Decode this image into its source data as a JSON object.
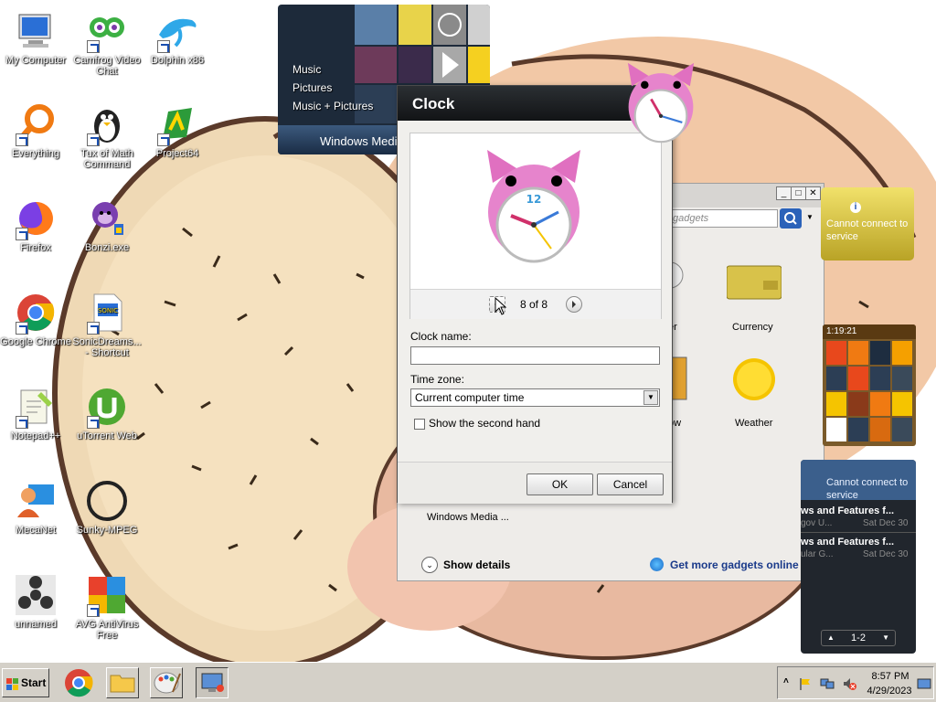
{
  "desktop": {
    "icons": [
      {
        "label": "My Computer",
        "shortcut": false
      },
      {
        "label": "Camfrog Video Chat",
        "shortcut": true
      },
      {
        "label": "Dolphin x86",
        "shortcut": true
      },
      {
        "label": "Everything",
        "shortcut": true
      },
      {
        "label": "Tux of Math Command",
        "shortcut": true
      },
      {
        "label": "Project64",
        "shortcut": true
      },
      {
        "label": "Firefox",
        "shortcut": true
      },
      {
        "label": "Bonzi.exe",
        "shortcut": true
      },
      {
        "label": "Google Chrome",
        "shortcut": true
      },
      {
        "label": "SonicDreams... - Shortcut",
        "shortcut": true
      },
      {
        "label": "Notepad++",
        "shortcut": true
      },
      {
        "label": "uTorrent Web",
        "shortcut": true
      },
      {
        "label": "MecaNet",
        "shortcut": false
      },
      {
        "label": "Sunky-MPEG",
        "shortcut": false
      },
      {
        "label": "unnamed",
        "shortcut": false
      },
      {
        "label": "AVG AntiVirus Free",
        "shortcut": true
      }
    ]
  },
  "media_center_gadget": {
    "items": [
      "Music",
      "Pictures",
      "Music + Pictures"
    ],
    "footer": "Windows Media Center"
  },
  "clock_dialog": {
    "title": "Clock",
    "pager_text": "8 of 8",
    "clock_name_label": "Clock name:",
    "clock_name_value": "",
    "time_zone_label": "Time zone:",
    "time_zone_value": "Current computer time",
    "second_hand_label": "Show the second hand",
    "second_hand_checked": false,
    "ok_label": "OK",
    "cancel_label": "Cancel",
    "clock_12": "12"
  },
  "gadget_gallery": {
    "search_placeholder": "gadgets",
    "items": [
      "er",
      "Currency",
      "ow",
      "Weather"
    ],
    "selected_item": "Windows Media ...",
    "show_details": "Show details",
    "get_more": "Get more gadgets online"
  },
  "side_gadgets": {
    "currency_error": "Cannot connect to service",
    "puzzle_time": "1:19:21",
    "feed_error": "Cannot connect to service",
    "feed_items": [
      {
        "title": "ws and Features f...",
        "source": "gov U...",
        "date": "Sat Dec 30"
      },
      {
        "title": "ws and Features f...",
        "source": "ular G...",
        "date": "Sat Dec 30"
      }
    ],
    "feed_pager": "1-2"
  },
  "taskbar": {
    "start_label": "Start",
    "time": "8:57 PM",
    "date": "4/29/2023"
  },
  "colors": {
    "dialog_header": "#1b1e21",
    "taskbar": "#d4d0c8",
    "link_blue": "#1a3a8a"
  }
}
